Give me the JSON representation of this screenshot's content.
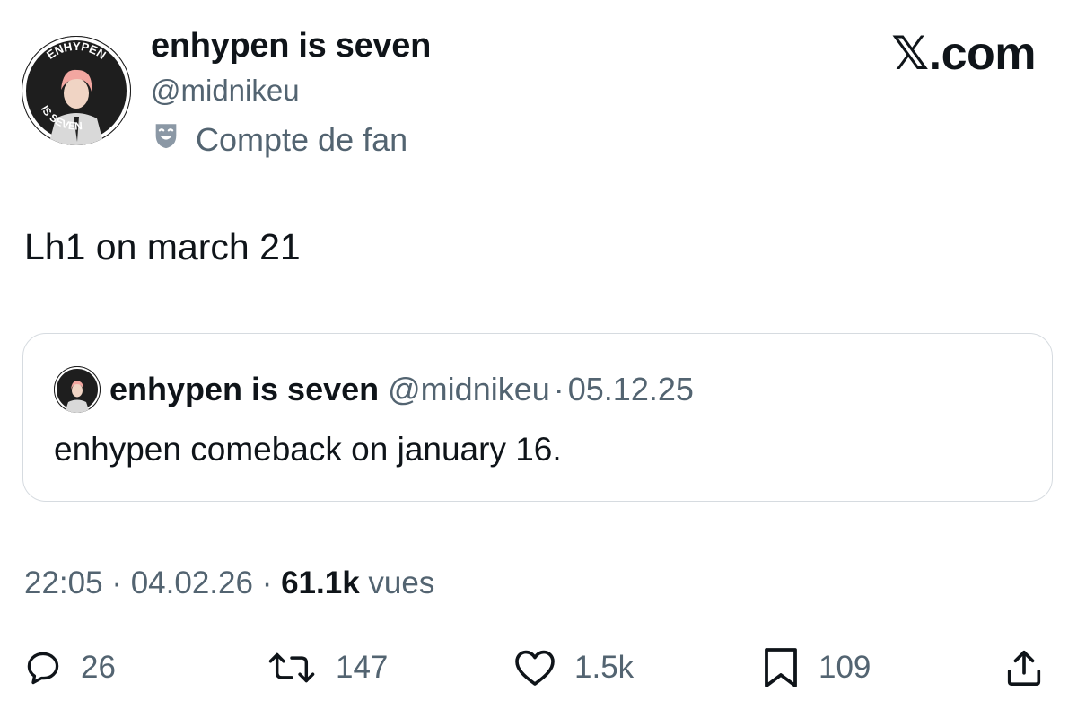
{
  "author": {
    "name": "enhypen is seven",
    "handle": "@midnikeu",
    "badge_label": "Compte de fan",
    "avatar_ring_text_top": "ENHYPEN",
    "avatar_ring_text_bottom": "IS SEVEN"
  },
  "brand": "𝕏.com",
  "tweet": {
    "text": "Lh1 on march 21"
  },
  "quoted": {
    "name": "enhypen is seven",
    "handle": "@midnikeu",
    "separator": "·",
    "date": "05.12.25",
    "text": "enhypen comeback on january 16."
  },
  "meta": {
    "time": "22:05",
    "separator": "·",
    "date": "04.02.26",
    "views_count": "61.1k",
    "views_label": "vues"
  },
  "actions": {
    "replies": "26",
    "reposts": "147",
    "likes": "1.5k",
    "bookmarks": "109"
  },
  "icons": {
    "reply": "reply-icon",
    "repost": "repost-icon",
    "like": "heart-icon",
    "bookmark": "bookmark-icon",
    "share": "share-icon",
    "badge": "theater-mask-icon"
  },
  "colors": {
    "text": "#0f1419",
    "secondary": "#536471",
    "border": "#d6dbe0"
  }
}
